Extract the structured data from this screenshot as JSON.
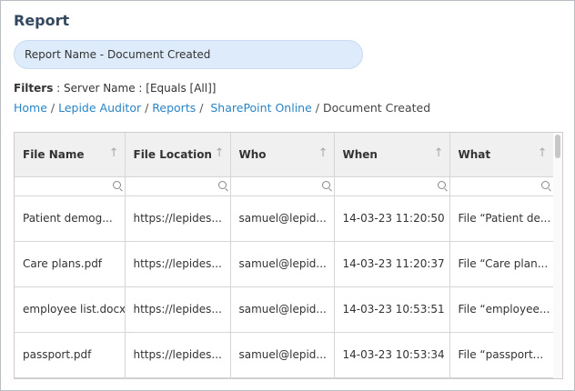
{
  "page": {
    "title": "Report",
    "report_name": "Report Name - Document Created",
    "filters_label": "Filters",
    "filters_value": " : Server Name : [Equals [All]]"
  },
  "breadcrumb": {
    "items": [
      "Home",
      "Lepide Auditor",
      "Reports",
      "SharePoint Online"
    ],
    "current": "Document Created"
  },
  "table": {
    "columns": [
      "File Name",
      "File Location",
      "Who",
      "When",
      "What"
    ],
    "sort_icon": "up-arrow-icon",
    "filter_icon": "search-icon",
    "rows": [
      [
        "Patient demog...",
        "https://lepides...",
        "samuel@lepid...",
        "14-03-23 11:20:50",
        "File “Patient de..."
      ],
      [
        "Care plans.pdf",
        "https://lepides...",
        "samuel@lepid...",
        "14-03-23 11:20:37",
        "File “Care plan..."
      ],
      [
        "employee list.docx",
        "https://lepides...",
        "samuel@lepid...",
        "14-03-23 10:53:51",
        "File “employee..."
      ],
      [
        "passport.pdf",
        "https://lepides...",
        "samuel@lepid...",
        "14-03-23 10:53:34",
        "File “passport..."
      ]
    ]
  },
  "colors": {
    "link": "#2a84c6",
    "title": "#34495e",
    "pill_bg": "#deebfa",
    "header_bg": "#f0f0f0"
  }
}
